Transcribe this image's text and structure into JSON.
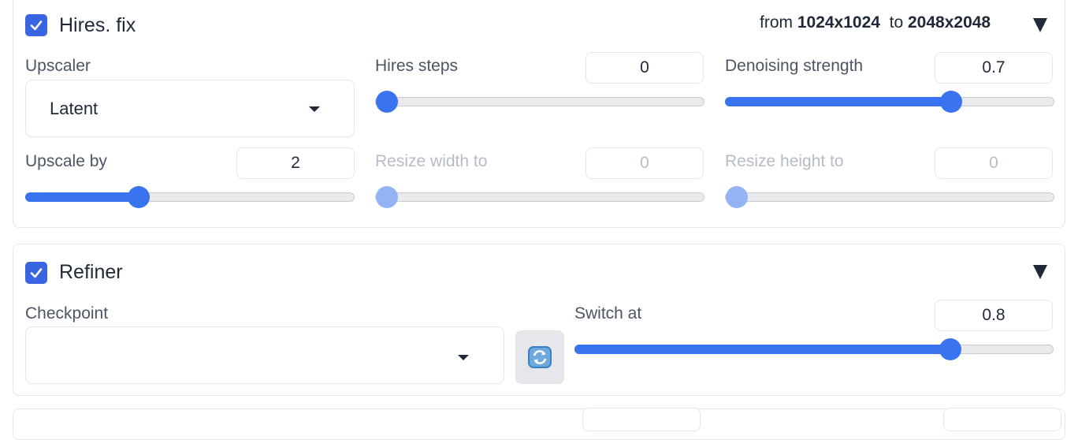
{
  "hires": {
    "enabled": true,
    "title": "Hires. fix",
    "summary": {
      "from_label": "from",
      "from_value": "1024x1024",
      "to_label": "to",
      "to_value": "2048x2048"
    },
    "upscaler": {
      "label": "Upscaler",
      "value": "Latent"
    },
    "hires_steps": {
      "label": "Hires steps",
      "value": "0",
      "fraction": 0.0
    },
    "denoising": {
      "label": "Denoising strength",
      "value": "0.7",
      "fraction": 0.7
    },
    "upscale_by": {
      "label": "Upscale by",
      "value": "2",
      "fraction": 0.333
    },
    "resize_width": {
      "label": "Resize width to",
      "value": "0",
      "fraction": 0.0,
      "disabled": true
    },
    "resize_height": {
      "label": "Resize height to",
      "value": "0",
      "fraction": 0.0,
      "disabled": true
    }
  },
  "refiner": {
    "enabled": true,
    "title": "Refiner",
    "checkpoint": {
      "label": "Checkpoint",
      "value": ""
    },
    "switch_at": {
      "label": "Switch at",
      "value": "0.8",
      "fraction": 0.8
    }
  },
  "colors": {
    "accent": "#3a73f0",
    "checkbox": "#3a65e0",
    "disabled_thumb": "#93b3f5",
    "track": "#e9eaec"
  },
  "icons": {
    "checkbox": "checkmark-icon",
    "collapse": "triangle-down-icon",
    "dropdown": "chevron-down-icon",
    "refresh": "refresh-icon"
  }
}
